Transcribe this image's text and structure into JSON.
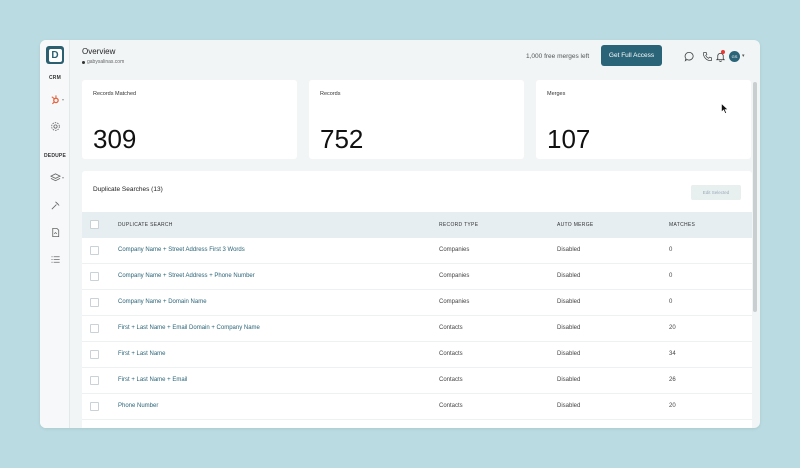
{
  "sidebar": {
    "logo_letter": "D",
    "section_crm": "CRM",
    "section_dedupe": "DEDUPE"
  },
  "header": {
    "title": "Overview",
    "subtitle": "gabysalinas.com",
    "merges_left": "1,000 free merges left",
    "cta_label": "Get Full Access",
    "avatar_initials": "GS"
  },
  "stats": [
    {
      "label": "Records Matched",
      "value": "309"
    },
    {
      "label": "Records",
      "value": "752"
    },
    {
      "label": "Merges",
      "value": "107"
    }
  ],
  "table": {
    "title": "Duplicate Searches (13)",
    "edit_button": "Edit Selected",
    "columns": [
      "DUPLICATE SEARCH",
      "RECORD TYPE",
      "AUTO MERGE",
      "MATCHES"
    ],
    "rows": [
      {
        "name": "Company Name + Street Address First 3 Words",
        "type": "Companies",
        "auto": "Disabled",
        "matches": "0"
      },
      {
        "name": "Company Name + Street Address + Phone Number",
        "type": "Companies",
        "auto": "Disabled",
        "matches": "0"
      },
      {
        "name": "Company Name + Domain Name",
        "type": "Companies",
        "auto": "Disabled",
        "matches": "0"
      },
      {
        "name": "First + Last Name + Email Domain + Company Name",
        "type": "Contacts",
        "auto": "Disabled",
        "matches": "20"
      },
      {
        "name": "First + Last Name",
        "type": "Contacts",
        "auto": "Disabled",
        "matches": "34"
      },
      {
        "name": "First + Last Name + Email",
        "type": "Contacts",
        "auto": "Disabled",
        "matches": "26"
      },
      {
        "name": "Phone Number",
        "type": "Contacts",
        "auto": "Disabled",
        "matches": "20"
      }
    ]
  },
  "colors": {
    "accent": "#2a6478",
    "hubspot": "#e8603c",
    "background": "#b9dbe1"
  }
}
